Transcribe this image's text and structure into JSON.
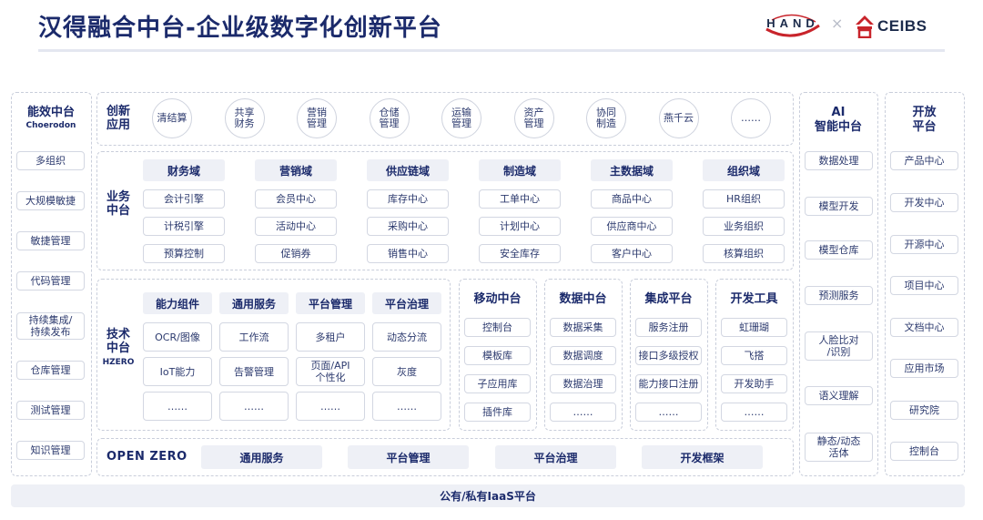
{
  "title": "汉得融合中台-企业级数字化创新平台",
  "logos": {
    "hand": "HAND",
    "separator": "×",
    "ceibs": "CEIBS"
  },
  "left_column": {
    "title": "能效中台",
    "subtitle": "Choerodon",
    "items": [
      "多组织",
      "大规模敏捷",
      "敏捷管理",
      "代码管理",
      "持续集成/\n持续发布",
      "仓库管理",
      "测试管理",
      "知识管理"
    ]
  },
  "innovation": {
    "label": "创新\n应用",
    "items": [
      "清结算",
      "共享\n财务",
      "营销\n管理",
      "仓储\n管理",
      "运输\n管理",
      "资产\n管理",
      "协同\n制造",
      "燕千云",
      "……"
    ]
  },
  "business": {
    "label": "业务\n中台",
    "domains": [
      {
        "name": "财务域",
        "items": [
          "会计引擎",
          "计税引擎",
          "预算控制"
        ]
      },
      {
        "name": "营销域",
        "items": [
          "会员中心",
          "活动中心",
          "促销券"
        ]
      },
      {
        "name": "供应链域",
        "items": [
          "库存中心",
          "采购中心",
          "销售中心"
        ]
      },
      {
        "name": "制造域",
        "items": [
          "工单中心",
          "计划中心",
          "安全库存"
        ]
      },
      {
        "name": "主数据域",
        "items": [
          "商品中心",
          "供应商中心",
          "客户中心"
        ]
      },
      {
        "name": "组织域",
        "items": [
          "HR组织",
          "业务组织",
          "核算组织"
        ]
      }
    ]
  },
  "technical": {
    "label": "技术\n中台",
    "sublabel": "HZERO",
    "groups": [
      {
        "name": "能力组件",
        "items": [
          "OCR/图像",
          "IoT能力",
          "……"
        ]
      },
      {
        "name": "通用服务",
        "items": [
          "工作流",
          "告警管理",
          "……"
        ]
      },
      {
        "name": "平台管理",
        "items": [
          "多租户",
          "页面/API\n个性化",
          "……"
        ]
      },
      {
        "name": "平台治理",
        "items": [
          "动态分流",
          "灰度",
          "……"
        ]
      }
    ]
  },
  "side_platforms": [
    {
      "name": "移动中台",
      "items": [
        "控制台",
        "模板库",
        "子应用库",
        "插件库"
      ]
    },
    {
      "name": "数据中台",
      "items": [
        "数据采集",
        "数据调度",
        "数据治理",
        "……"
      ]
    },
    {
      "name": "集成平台",
      "items": [
        "服务注册",
        "接口多级授权",
        "能力接口注册",
        "……"
      ]
    },
    {
      "name": "开发工具",
      "items": [
        "虹珊瑚",
        "飞搭",
        "开发助手",
        "……"
      ]
    }
  ],
  "open_zero": {
    "label": "OPEN ZERO",
    "items": [
      "通用服务",
      "平台管理",
      "平台治理",
      "开发框架"
    ]
  },
  "ai_column": {
    "title": "AI\n智能中台",
    "items": [
      "数据处理",
      "模型开发",
      "模型仓库",
      "预测服务",
      "人脸比对\n/识别",
      "语义理解",
      "静态/动态\n活体"
    ]
  },
  "open_column": {
    "title": "开放\n平台",
    "items": [
      "产品中心",
      "开发中心",
      "开源中心",
      "项目中心",
      "文档中心",
      "应用市场",
      "研究院",
      "控制台"
    ]
  },
  "footer": "公有/私有IaaS平台",
  "colors": {
    "primary": "#1b2a6b",
    "accent_red": "#c8242b",
    "fill": "#eef0f6",
    "border": "#c9cedb"
  }
}
